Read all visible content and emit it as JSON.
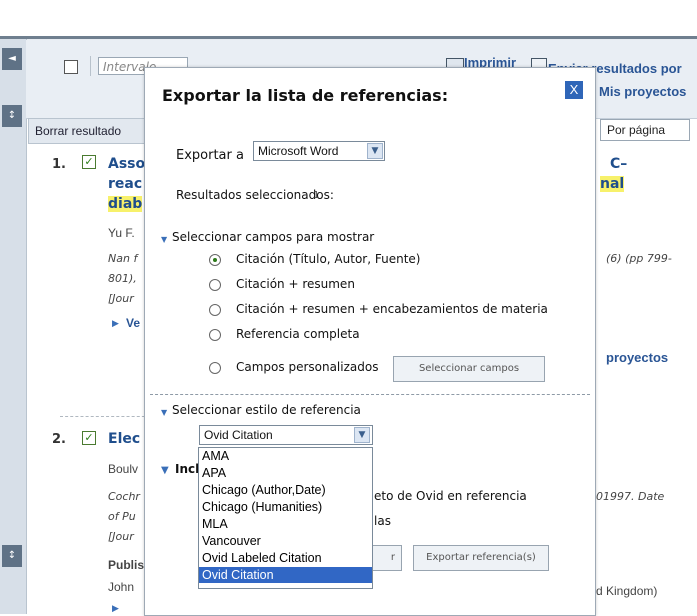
{
  "page": {
    "select_all_checkbox": "",
    "interval_placeholder": "Intervalo",
    "print_link": "Imprimir",
    "send_results_link": "Enviar resultados por",
    "my_projects_link": "Mis proyectos",
    "clear_results_button": "Borrar resultado",
    "per_page_label": "Por página",
    "results": [
      {
        "number": "1.",
        "title_start": "Asso",
        "title_right": "C–",
        "title_line2_start": "reac",
        "title_line2_right": "nal",
        "title_line3_start": "diab",
        "authors": "Yu F.",
        "source_start": "Nan f",
        "source_right": "(6) (pp 799-",
        "source_line2": "801),",
        "source_line3": "[Jour",
        "view_link": "Ve",
        "projects_link": "proyectos"
      },
      {
        "number": "2.",
        "title_start": "Elec",
        "authors": "Boulv",
        "source_start": "Cochr",
        "source_right": "01997. Date",
        "source_line2": "of Pu",
        "source_line3": "[Jour",
        "publisher_label": "Publis",
        "publisher_line": "John",
        "publisher_right": "d Kingdom)"
      }
    ]
  },
  "modal": {
    "title": "Exportar la lista de referencias:",
    "close_label": "X",
    "export_to_label": "Exportar a",
    "export_to_value": "Microsoft Word",
    "selected_results_label": "Resultados seleccionados:",
    "selected_results_overlay": "1",
    "fields_section_label": "Seleccionar campos para mostrar",
    "field_options": [
      {
        "label": "Citación (Título, Autor, Fuente)",
        "checked": true
      },
      {
        "label": "Citación + resumen",
        "checked": false
      },
      {
        "label": "Citación + resumen + encabezamientos de materia",
        "checked": false
      },
      {
        "label": "Referencia completa",
        "checked": false
      },
      {
        "label": "Campos personalizados",
        "checked": false
      }
    ],
    "select_fields_button": "Seleccionar campos",
    "style_section_label": "Seleccionar estilo de referencia",
    "style_value": "Ovid Citation",
    "include_section_start": "Incl",
    "include_option_1_end": "eto de Ovid en referencia",
    "include_option_2_end": "las",
    "cancel_button_end": "r",
    "export_button": "Exportar referencia(s)",
    "style_options": [
      {
        "label": "AMA",
        "selected": false
      },
      {
        "label": "APA",
        "selected": false
      },
      {
        "label": "Chicago (Author,Date)",
        "selected": false
      },
      {
        "label": "Chicago (Humanities)",
        "selected": false
      },
      {
        "label": "MLA",
        "selected": false
      },
      {
        "label": "Vancouver",
        "selected": false
      },
      {
        "label": "Ovid Labeled Citation",
        "selected": false
      },
      {
        "label": "Ovid Citation",
        "selected": true
      }
    ]
  },
  "colors": {
    "accent": "#2f66b8",
    "title_link": "#1f4e8c",
    "highlight": "#f7f16b",
    "selected_option": "#3167c5",
    "checked_radio": "#2d7a1a"
  },
  "icons": {
    "left_tab_top": "◄",
    "left_tab_mid": "↕",
    "print_icon": "printer-icon",
    "email_icon": "envelope-icon"
  }
}
